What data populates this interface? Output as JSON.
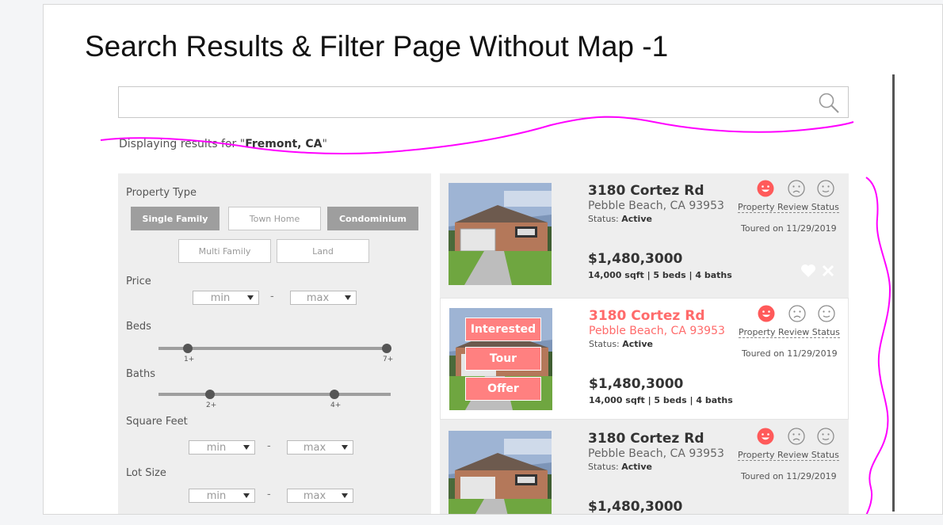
{
  "page": {
    "title": "Search Results & Filter Page Without Map -1"
  },
  "search": {
    "value": "",
    "placeholder": ""
  },
  "results": {
    "prefix": "Displaying results for \"",
    "location": "Fremont, CA",
    "suffix": "\""
  },
  "filters": {
    "property_type": {
      "label": "Property Type",
      "options": [
        {
          "label": "Single Family",
          "selected": true
        },
        {
          "label": "Town Home",
          "selected": false
        },
        {
          "label": "Condominium",
          "selected": true
        },
        {
          "label": "Multi Family",
          "selected": false
        },
        {
          "label": "Land",
          "selected": false
        }
      ]
    },
    "price": {
      "label": "Price",
      "min": "min",
      "max": "max",
      "separator": "-"
    },
    "beds": {
      "label": "Beds",
      "low": "1+",
      "high": "7+"
    },
    "baths": {
      "label": "Baths",
      "low": "2+",
      "high": "4+"
    },
    "square_feet": {
      "label": "Square Feet",
      "min": "min",
      "max": "max",
      "separator": "-"
    },
    "lot_size": {
      "label": "Lot Size",
      "min": "min",
      "max": "max",
      "separator": "-"
    }
  },
  "listings": [
    {
      "address": "3180 Cortez Rd",
      "city": "Pebble Beach, CA 93953",
      "status_label": "Status: ",
      "status": "Active",
      "price": "$1,480,3000",
      "specs": "14,000 sqft | 5 beds | 4 baths",
      "review_link": "Property Review Status",
      "toured": "Toured on 11/29/2019"
    },
    {
      "address": "3180 Cortez Rd",
      "city": "Pebble Beach, CA 93953",
      "status_label": "Status: ",
      "status": "Active",
      "price": "$1,480,3000",
      "specs": "14,000 sqft | 5 beds | 4 baths",
      "review_link": "Property Review Status",
      "toured": "Toured on 11/29/2019",
      "overlay": [
        "Interested",
        "Tour",
        "Offer"
      ]
    },
    {
      "address": "3180 Cortez Rd",
      "city": "Pebble Beach, CA 93953",
      "status_label": "Status: ",
      "status": "Active",
      "price": "$1,480,3000",
      "specs": "",
      "review_link": "Property Review Status",
      "toured": "Toured on 11/29/2019"
    }
  ],
  "colors": {
    "accent": "#ff6b6b",
    "overlay_button": "#ff8080",
    "filter_bg": "#eeeeee",
    "selected_chip": "#9e9e9e",
    "annotation": "#ff00ff"
  },
  "icons": {
    "search": "search-icon",
    "happy": "happy-face-icon",
    "sad": "sad-face-icon",
    "neutral": "neutral-face-icon",
    "favorite": "heart-icon",
    "dismiss": "close-icon"
  }
}
